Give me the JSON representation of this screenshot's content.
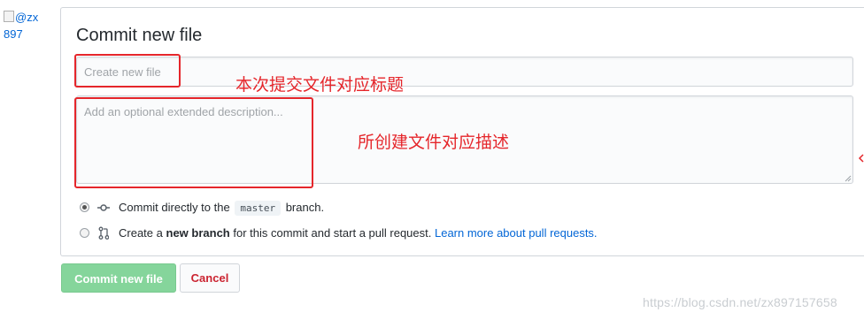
{
  "avatar": {
    "alt_line1": "@zx",
    "alt_line2": "897"
  },
  "panel": {
    "title": "Commit new file"
  },
  "fields": {
    "summary_placeholder": "Create new file",
    "description_placeholder": "Add an optional extended description..."
  },
  "annotations": {
    "summary_note": "本次提交文件对应标题",
    "description_note": "所创建文件对应描述"
  },
  "options": {
    "direct": {
      "before": "Commit directly to the",
      "branch": "master",
      "after": "branch.",
      "selected": true
    },
    "new_branch": {
      "pre": "Create a",
      "bold": "new branch",
      "post": "for this commit and start a pull request.",
      "link": "Learn more about pull requests."
    }
  },
  "buttons": {
    "commit": "Commit new file",
    "cancel": "Cancel"
  },
  "colors": {
    "annotation_red": "#e5262b",
    "commit_green": "#85d59b",
    "cancel_red": "#cb2431",
    "link_blue": "#0366d6"
  },
  "watermark": "https://blog.csdn.net/zx897157658"
}
